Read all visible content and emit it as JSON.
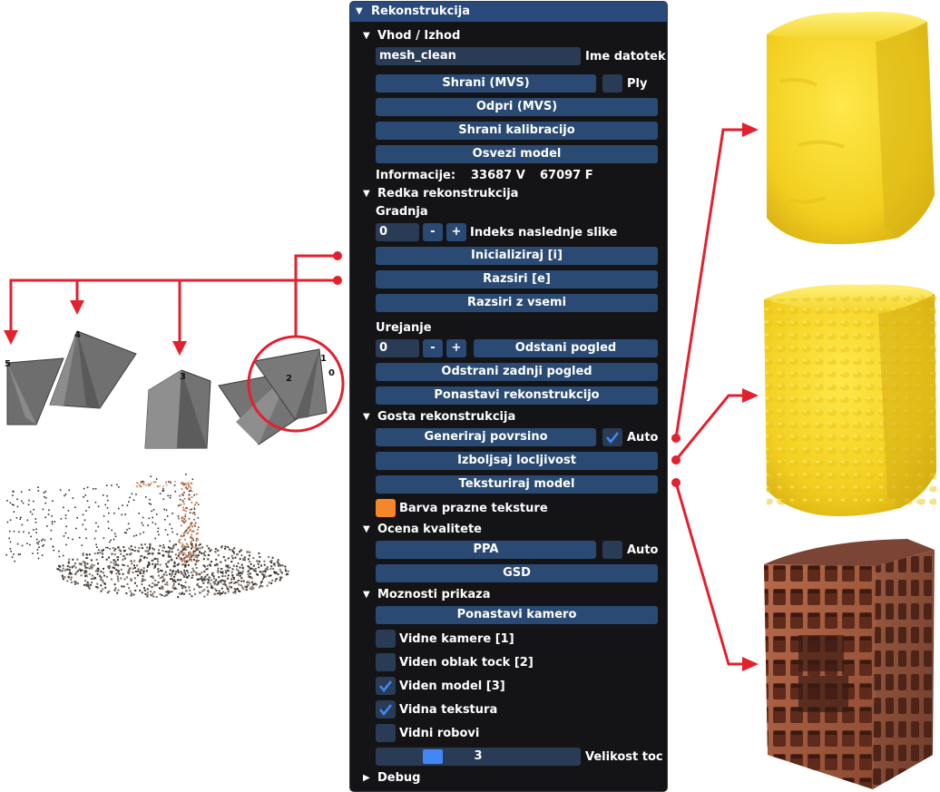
{
  "colors": {
    "accent": "#4287f5",
    "button": "#2a4a73",
    "frame": "#2a3b55",
    "panel_bg": "#141417",
    "title_bg": "#294a7a",
    "annotation": "#e3202e",
    "texture_swatch": "#f5862a"
  },
  "panel": {
    "title": "Rekonstrukcija",
    "io": {
      "header": "Vhod / Izhod",
      "filename_value": "mesh_clean",
      "filename_label": "Ime datotek",
      "save_mvs": "Shrani (MVS)",
      "ply_label": "Ply",
      "ply_checked": false,
      "open_mvs": "Odpri (MVS)",
      "save_calibration": "Shrani kalibracijo",
      "refresh_model": "Osvezi model",
      "info_label": "Informacije:",
      "vertices": "33687 V",
      "faces": "67097 F"
    },
    "sparse": {
      "header": "Redka rekonstrukcija",
      "build_label": "Gradnja",
      "next_index_value": "0",
      "minus": "-",
      "plus": "+",
      "next_index_label": "Indeks naslednje slike",
      "initialize": "Inicializiraj [i]",
      "extend": "Razsiri [e]",
      "extend_all": "Razsiri z vsemi",
      "edit_label": "Urejanje",
      "view_index_value": "0",
      "remove_view": "Odstani pogled",
      "remove_last_view": "Odstrani zadnji pogled",
      "reset_reconstruction": "Ponastavi rekonstrukcijo"
    },
    "dense": {
      "header": "Gosta rekonstrukcija",
      "generate_surface": "Generiraj povrsino",
      "auto_label": "Auto",
      "auto_checked": true,
      "improve_resolution": "Izboljsaj locljivost",
      "texture_model": "Teksturiraj model",
      "empty_texture_color_label": "Barva prazne teksture"
    },
    "quality": {
      "header": "Ocena kvalitete",
      "ppa": "PPA",
      "auto_label": "Auto",
      "auto_checked": false,
      "gsd": "GSD"
    },
    "display": {
      "header": "Moznosti prikaza",
      "reset_camera": "Ponastavi kamero",
      "show_cameras": "Vidne kamere [1]",
      "show_cameras_checked": false,
      "show_point_cloud": "Viden oblak tock [2]",
      "show_point_cloud_checked": false,
      "show_model": "Viden model [3]",
      "show_model_checked": true,
      "show_texture": "Vidna tekstura",
      "show_texture_checked": true,
      "show_edges": "Vidni robovi",
      "show_edges_checked": false,
      "point_size_value": "3",
      "point_size_fraction": 0.25,
      "point_size_label": "Velikost toc"
    },
    "debug": {
      "header": "Debug"
    }
  },
  "scene": {
    "camera_labels": [
      "5",
      "4",
      "3",
      "2",
      "1",
      "0"
    ]
  }
}
